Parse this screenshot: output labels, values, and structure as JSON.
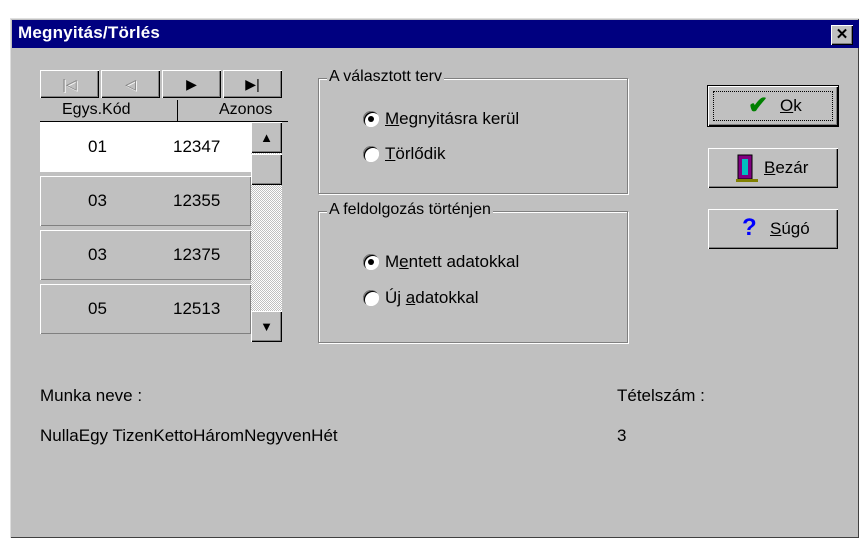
{
  "window": {
    "title": "Megnyitás/Törlés",
    "close_symbol": "✕"
  },
  "navigator": {
    "buttons": [
      {
        "icon": "first-record-icon",
        "glyph": "⏮"
      },
      {
        "icon": "prior-record-icon",
        "glyph": "◁"
      },
      {
        "icon": "next-record-icon",
        "glyph": "►"
      },
      {
        "icon": "last-record-icon",
        "glyph": "►|"
      }
    ]
  },
  "grid": {
    "columns": [
      "Egys.Kód",
      "Azonos"
    ],
    "rows": [
      {
        "kod": "01",
        "azonos": "12347"
      },
      {
        "kod": "03",
        "azonos": "12355"
      },
      {
        "kod": "03",
        "azonos": "12375"
      },
      {
        "kod": "05",
        "azonos": "12513"
      }
    ],
    "scroll_up": "▲",
    "scroll_down": "▼"
  },
  "group_plan": {
    "legend": "A választott terv",
    "options": [
      {
        "label_underline": "M",
        "label_rest": "egnyitásra kerül",
        "checked": true
      },
      {
        "label_underline": "T",
        "label_rest": "örlődik",
        "checked": false
      }
    ]
  },
  "group_process": {
    "legend": "A feldolgozás történjen",
    "options": [
      {
        "label_pre": "M",
        "label_underline": "e",
        "label_rest": "ntett adatokkal",
        "checked": true
      },
      {
        "label_pre": "Új ",
        "label_underline": "a",
        "label_rest": "datokkal",
        "checked": false
      }
    ]
  },
  "buttons": {
    "ok": {
      "underline": "O",
      "rest": "k",
      "icon": "checkmark-icon",
      "color": "#008000"
    },
    "close": {
      "underline": "B",
      "rest": "ezár",
      "icon": "door-exit-icon"
    },
    "help": {
      "underline": "S",
      "rest": "úgó",
      "icon": "question-mark-icon",
      "color": "#0000ff"
    }
  },
  "info": {
    "munka_label": "Munka neve :",
    "munka_value": "NullaEgy TizenKettoHáromNegyvenHét",
    "tetel_label": "Tételszám :",
    "tetel_value": "3"
  }
}
